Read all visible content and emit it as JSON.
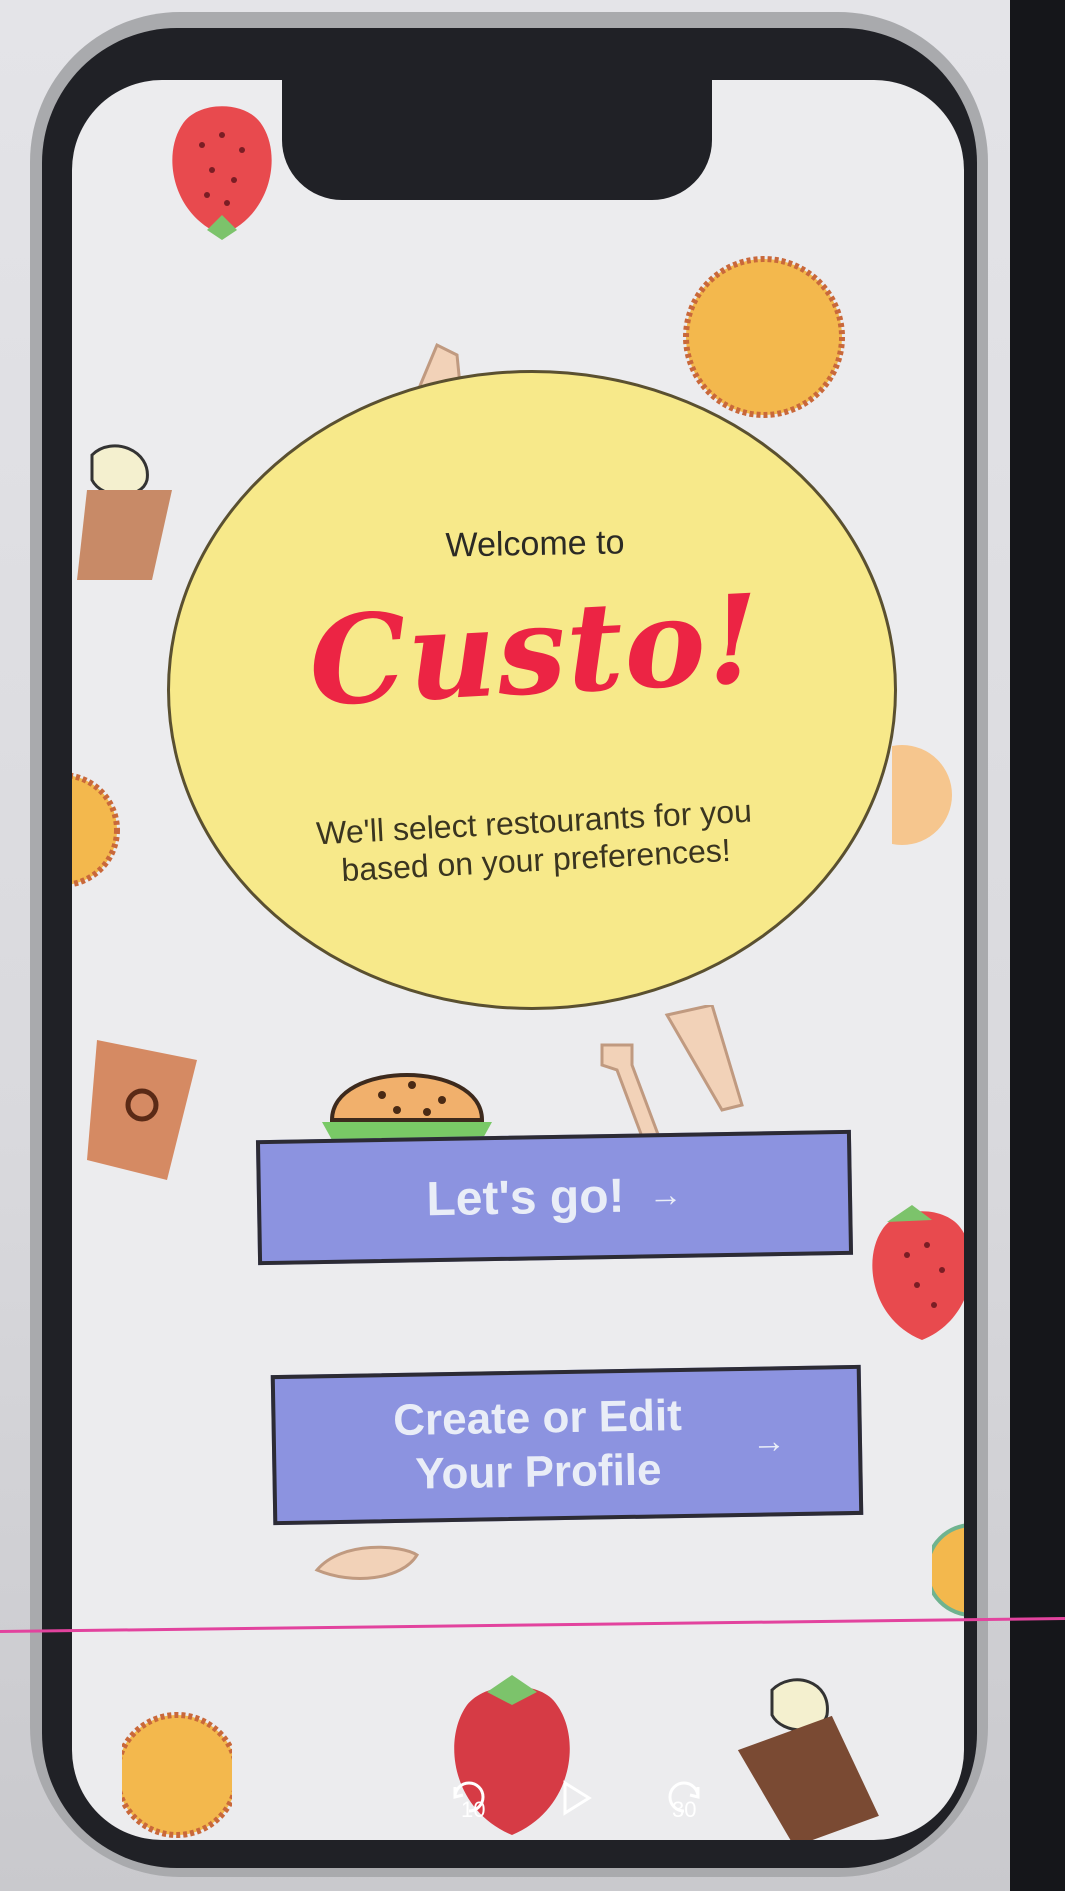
{
  "screen": {
    "welcome_prefix": "Welcome to",
    "brand_name": "Custo!",
    "tagline_line1": "We'll select restourants for you",
    "tagline_line2": "based on your preferences!",
    "primary_button": {
      "label": "Let's go!",
      "arrow": "→"
    },
    "secondary_button": {
      "label_line1": "Create or Edit",
      "label_line2": "Your Profile",
      "arrow": "→"
    }
  },
  "media_controls": {
    "rewind_label": "10",
    "forward_label": "30"
  },
  "colors": {
    "brand_red": "#ec2444",
    "hero_yellow": "#f7e98a",
    "button_blue": "#8c93e0",
    "frame_dark": "#202126"
  },
  "icons": [
    "strawberry-icon",
    "burger-icon",
    "ice-cream-cup-icon",
    "fork-knife-icon",
    "cookie-icon",
    "rewind-10-icon",
    "play-icon",
    "forward-30-icon"
  ]
}
